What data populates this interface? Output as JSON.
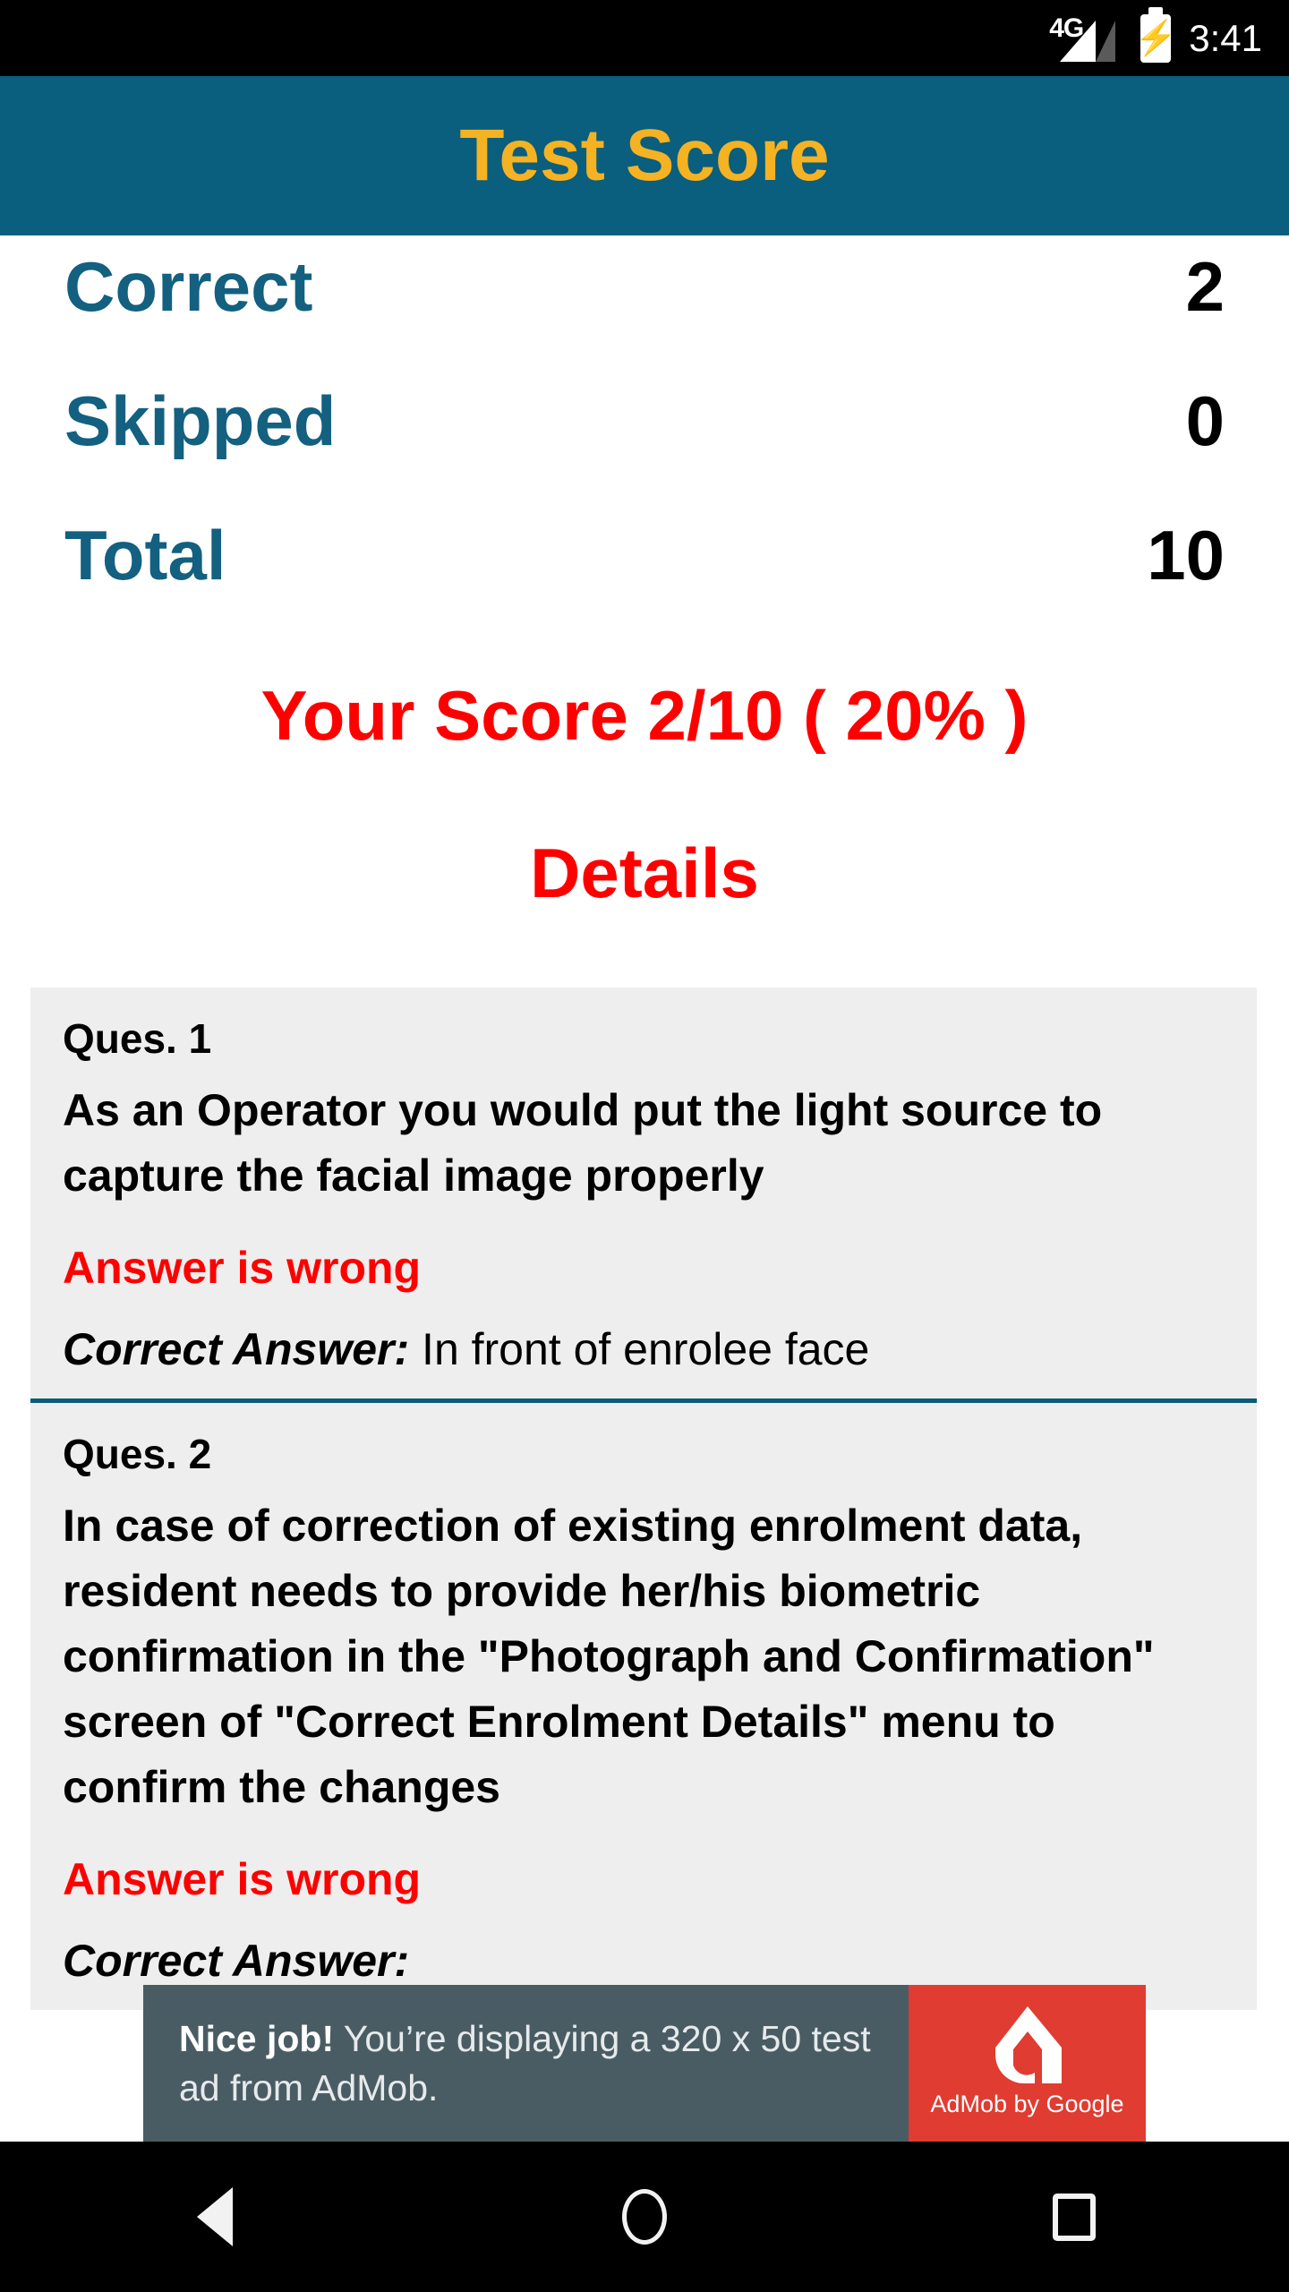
{
  "status_bar": {
    "network_label": "4G",
    "signal_icon": "signal-bars-icon",
    "battery_icon": "battery-charging-icon",
    "time": "3:41"
  },
  "app_bar": {
    "title": "Test Score",
    "background_color": "#0a5e7e",
    "title_color": "#f5b222"
  },
  "summary": {
    "rows": [
      {
        "label": "Correct",
        "value": "2"
      },
      {
        "label": "Skipped",
        "value": "0"
      },
      {
        "label": "Total",
        "value": "10"
      }
    ],
    "label_color": "#136080",
    "value_color": "#000000"
  },
  "score": {
    "text": "Your Score 2/10 ( 20% )",
    "color": "#ff0000",
    "correct": 2,
    "total": 10,
    "percent": "20%"
  },
  "details_heading": {
    "text": "Details",
    "color": "#ff0000"
  },
  "questions": [
    {
      "number_label": "Ques. 1",
      "question": "As an Operator you would put the light source to capture the facial image properly",
      "result": "Answer is wrong",
      "correct_answer_label": "Correct Answer:",
      "correct_answer_value": "In front of enrolee face"
    },
    {
      "number_label": "Ques. 2",
      "question": "In case of correction of existing enrolment data, resident needs to provide her/his biometric confirmation in the \"Photograph and Confirmation\" screen of \"Correct Enrolment Details\" menu to confirm the changes",
      "result": "Answer is wrong",
      "correct_answer_label": "Correct Answer:",
      "correct_answer_value": ""
    }
  ],
  "ad": {
    "headline": "Nice job!",
    "body": " You’re displaying a 320 x 50 test ad from AdMob.",
    "brand": "AdMob by Google",
    "logo_icon": "admob-logo-icon",
    "text_bg_color": "#4a5c63",
    "logo_bg_color": "#e03c31"
  },
  "nav_bar": {
    "back": "back-icon",
    "home": "home-icon",
    "recents": "recents-icon"
  }
}
